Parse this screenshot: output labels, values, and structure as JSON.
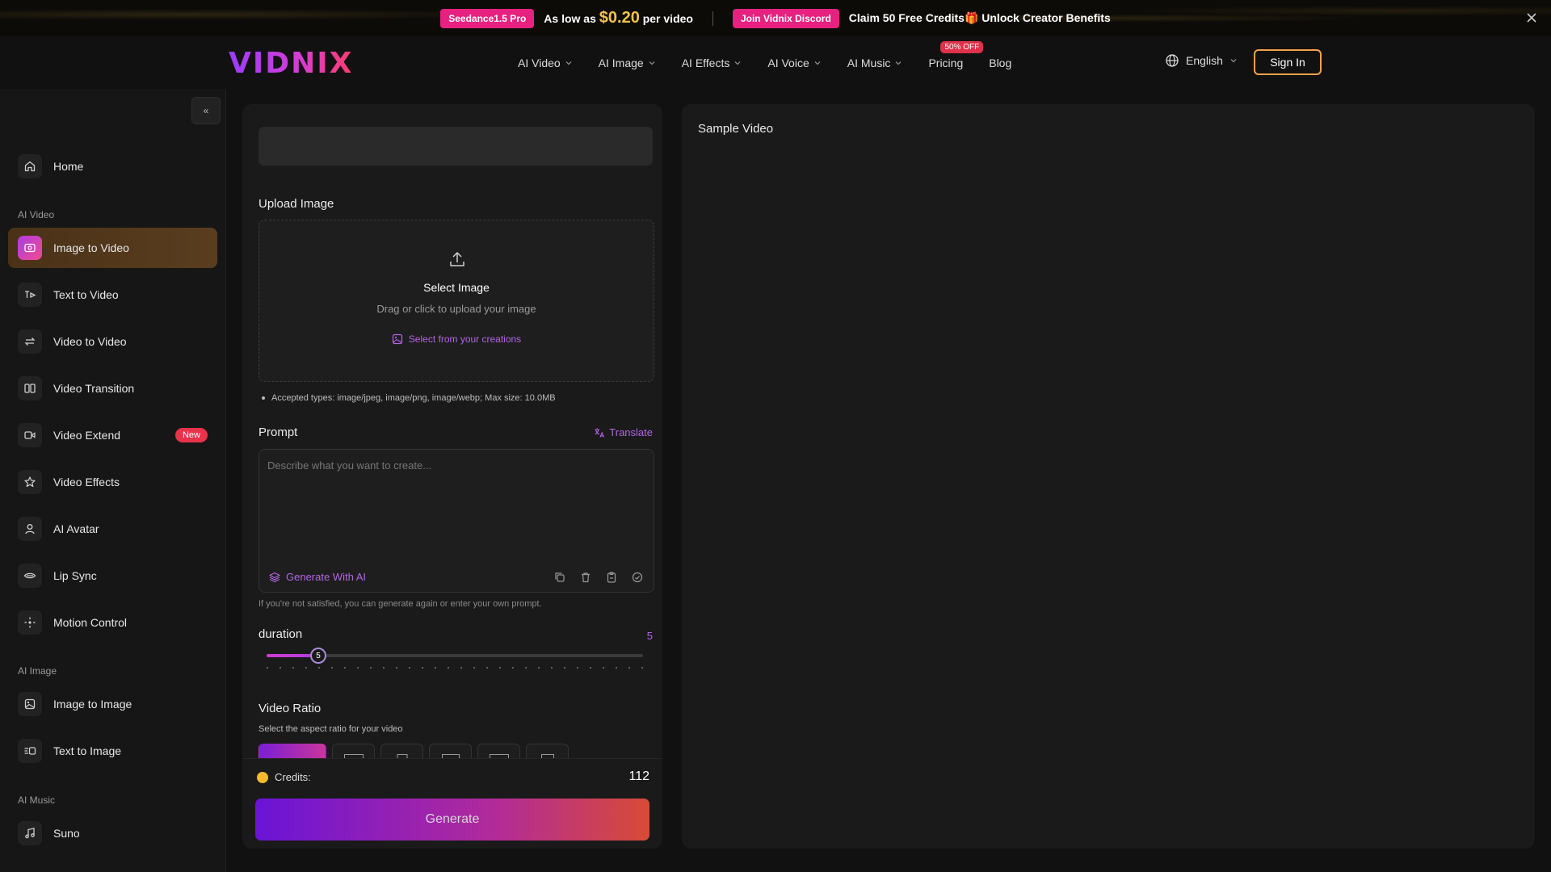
{
  "promo": {
    "badge": "Seedance1.5 Pro",
    "lead": "As low as",
    "price": "$0.20",
    "unit": "per video",
    "discord": "Join Vidnix Discord",
    "claim": "Claim 50 Free Credits🎁 Unlock Creator Benefits"
  },
  "header": {
    "logo": "VIDNIX",
    "nav": [
      {
        "label": "AI Video"
      },
      {
        "label": "AI Image"
      },
      {
        "label": "AI Effects"
      },
      {
        "label": "AI Voice"
      },
      {
        "label": "AI Music"
      },
      {
        "label": "Pricing",
        "badge": "50% OFF"
      },
      {
        "label": "Blog"
      }
    ],
    "language": "English",
    "signin": "Sign In"
  },
  "sidebar": {
    "collapse": "«",
    "home": "Home",
    "sections": [
      "AI Video",
      "AI Image",
      "AI Music"
    ],
    "video_items": [
      {
        "label": "Image to Video",
        "icon": "image-video-icon"
      },
      {
        "label": "Text to Video",
        "icon": "text-video-icon"
      },
      {
        "label": "Video to Video",
        "icon": "swap-icon"
      },
      {
        "label": "Video Transition",
        "icon": "transition-icon"
      },
      {
        "label": "Video Extend",
        "icon": "extend-icon",
        "badge": "New"
      },
      {
        "label": "Video Effects",
        "icon": "star-icon"
      },
      {
        "label": "AI Avatar",
        "icon": "person-icon"
      },
      {
        "label": "Lip Sync",
        "icon": "lips-icon"
      },
      {
        "label": "Motion Control",
        "icon": "move-icon"
      }
    ],
    "image_items": [
      {
        "label": "Image to Image",
        "icon": "image-icon"
      },
      {
        "label": "Text to Image",
        "icon": "text-image-icon"
      }
    ],
    "music_items": [
      {
        "label": "Suno",
        "icon": "music-icon"
      }
    ]
  },
  "form": {
    "upload_label": "Upload Image",
    "select_image": "Select Image",
    "drag_text": "Drag or click to upload your image",
    "select_creations": "Select from your creations",
    "accepted": "Accepted types: image/jpeg, image/png, image/webp; Max size: 10.0MB",
    "prompt_label": "Prompt",
    "translate": "Translate",
    "prompt_placeholder": "Describe what you want to create...",
    "generate_ai": "Generate With AI",
    "hint": "If you're not satisfied, you can generate again or enter your own prompt.",
    "duration_label": "duration",
    "duration_value": "5",
    "duration_min": 1,
    "duration_max": 30,
    "ratio_label": "Video Ratio",
    "ratio_sub": "Select the aspect ratio for your video",
    "credits_label": "Credits:",
    "credits_value": "112",
    "generate": "Generate"
  },
  "sample": {
    "title": "Sample Video"
  },
  "colors": {
    "accent": "#b366e6",
    "badge": "#e6217f",
    "price": "#f3c24a"
  }
}
